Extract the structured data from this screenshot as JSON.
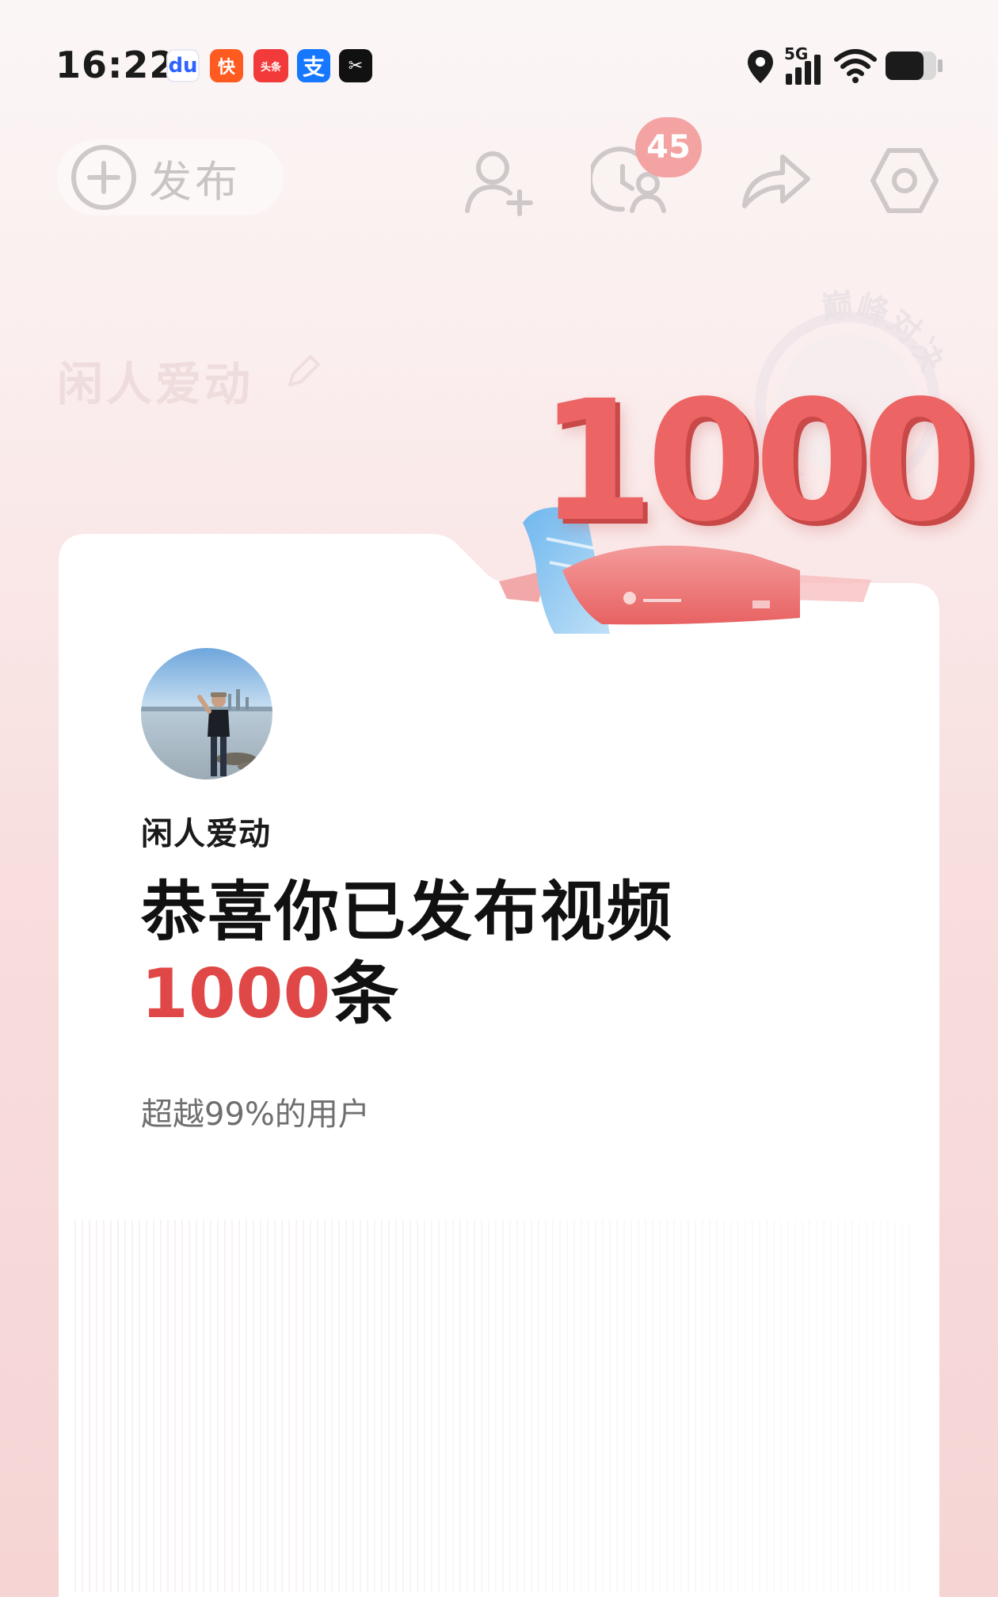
{
  "status_bar": {
    "time": "16:22",
    "notification_apps": [
      {
        "icon": "baidu-icon",
        "glyph": "du"
      },
      {
        "icon": "kuaishou-icon",
        "glyph": "快"
      },
      {
        "icon": "toutiao-icon",
        "glyph": "头条"
      },
      {
        "icon": "alipay-icon",
        "glyph": "支"
      },
      {
        "icon": "capcut-icon",
        "glyph": "✂"
      }
    ],
    "network": "5G",
    "indicators": [
      "location-icon",
      "signal-icon",
      "wifi-icon",
      "battery-icon"
    ]
  },
  "top_bar": {
    "publish_label": "发布",
    "notification_count": "45",
    "icons": [
      "plus-circle-icon",
      "add-friend-icon",
      "visitor-history-icon",
      "share-icon",
      "settings-icon"
    ]
  },
  "background_profile": {
    "username": "闲人爱动",
    "medal_text": "巅峰对决"
  },
  "milestone_graphic": {
    "number": "1000"
  },
  "card": {
    "username": "闲人爱动",
    "headline": "恭喜你已发布视频",
    "count_number": "1000",
    "count_unit": "条",
    "subtext": "超越99%的用户"
  },
  "colors": {
    "accent_red": "#e04848",
    "badge_pink": "#f4a3a3",
    "background_pink": "#f8dede"
  }
}
